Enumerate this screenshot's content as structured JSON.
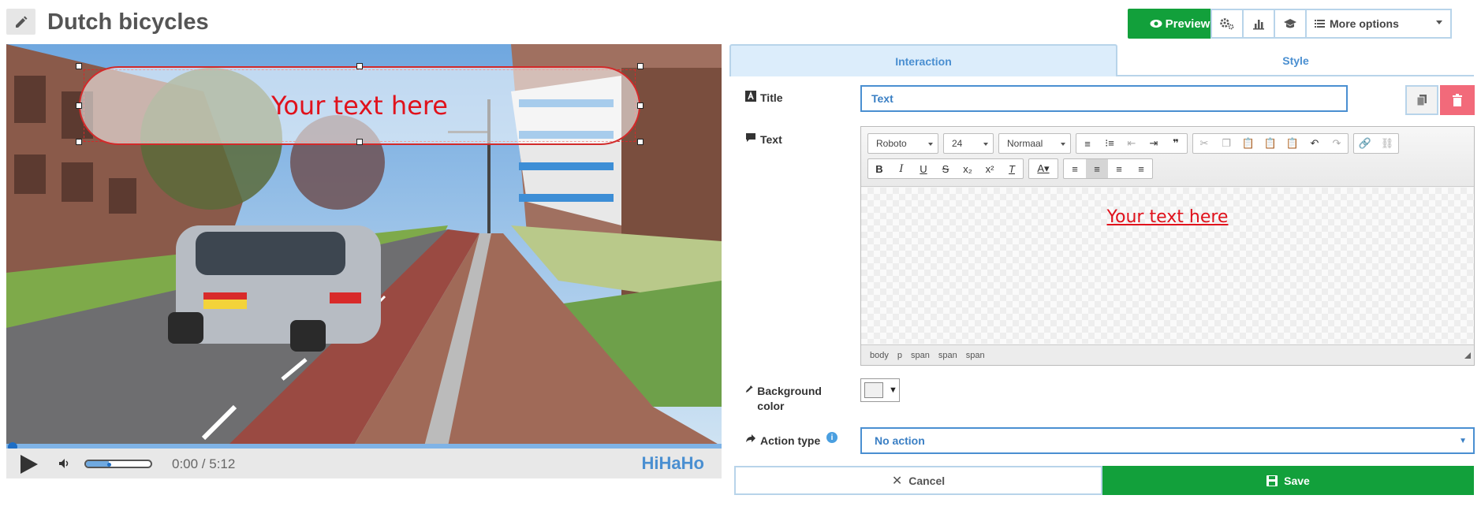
{
  "header": {
    "title": "Dutch bicycles",
    "preview_label": "Preview",
    "more_options_label": "More options"
  },
  "video": {
    "overlay_text": "Your text here",
    "time": "0:00 / 5:12",
    "brand": "HiHaHo",
    "progress": 0.0,
    "volume": 0.35
  },
  "tabs": [
    {
      "label": "Interaction",
      "active": true
    },
    {
      "label": "Style",
      "active": false
    }
  ],
  "form": {
    "title_label": "Title",
    "title_value": "Text",
    "text_label": "Text",
    "background_label": "Background color",
    "action_label": "Action type",
    "action_value": "No action"
  },
  "editor": {
    "font": "Roboto",
    "size": "24",
    "format": "Normaal",
    "content": "Your text here",
    "path": [
      "body",
      "p",
      "span",
      "span",
      "span"
    ]
  },
  "buttons": {
    "cancel": "Cancel",
    "save": "Save"
  },
  "colors": {
    "accent_green": "#12a03b",
    "accent_blue": "#4a8fd1",
    "overlay_red": "#e0121c",
    "delete_pink": "#f26a7a"
  }
}
